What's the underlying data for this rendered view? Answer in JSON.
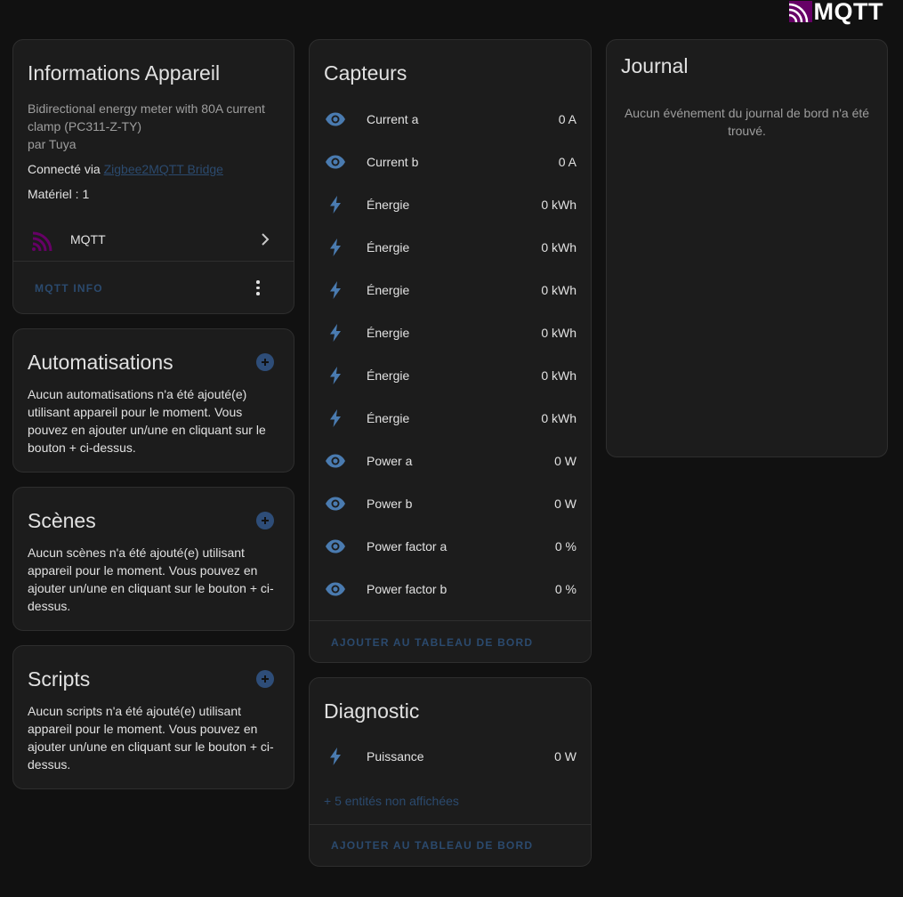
{
  "header": {
    "logo_text": "MQTT"
  },
  "colors": {
    "accent": "#2e4d78",
    "link": "#2b4a6e",
    "icon": "#4a7bb0",
    "mqtt_brand": "#660066"
  },
  "device_info": {
    "title": "Informations Appareil",
    "model": "Bidirectional energy meter with 80A current clamp (PC311-Z-TY)",
    "manufacturer": "par Tuya",
    "connected_label": "Connecté via",
    "connected_link": "Zigbee2MQTT Bridge",
    "hardware": "Matériel : 1",
    "integration_label": "MQTT",
    "action_label": "MQTT INFO"
  },
  "automations": {
    "title": "Automatisations",
    "text": "Aucun automatisations n'a été ajouté(e) utilisant appareil pour le moment. Vous pouvez en ajouter un/une en cliquant sur le bouton + ci-dessus."
  },
  "scenes": {
    "title": "Scènes",
    "text": "Aucun scènes n'a été ajouté(e) utilisant appareil pour le moment. Vous pouvez en ajouter un/une en cliquant sur le bouton + ci-dessus."
  },
  "scripts": {
    "title": "Scripts",
    "text": "Aucun scripts n'a été ajouté(e) utilisant appareil pour le moment. Vous pouvez en ajouter un/une en cliquant sur le bouton + ci-dessus."
  },
  "sensors": {
    "title": "Capteurs",
    "action_label": "AJOUTER AU TABLEAU DE BORD",
    "items": [
      {
        "icon": "eye-icon",
        "name": "Current a",
        "value": "0 A"
      },
      {
        "icon": "eye-icon",
        "name": "Current b",
        "value": "0 A"
      },
      {
        "icon": "flash-icon",
        "name": "Énergie",
        "value": "0 kWh"
      },
      {
        "icon": "flash-icon",
        "name": "Énergie",
        "value": "0 kWh"
      },
      {
        "icon": "flash-icon",
        "name": "Énergie",
        "value": "0 kWh"
      },
      {
        "icon": "flash-icon",
        "name": "Énergie",
        "value": "0 kWh"
      },
      {
        "icon": "flash-icon",
        "name": "Énergie",
        "value": "0 kWh"
      },
      {
        "icon": "flash-icon",
        "name": "Énergie",
        "value": "0 kWh"
      },
      {
        "icon": "eye-icon",
        "name": "Power a",
        "value": "0 W"
      },
      {
        "icon": "eye-icon",
        "name": "Power b",
        "value": "0 W"
      },
      {
        "icon": "eye-icon",
        "name": "Power factor a",
        "value": "0 %"
      },
      {
        "icon": "eye-icon",
        "name": "Power factor b",
        "value": "0 %"
      }
    ]
  },
  "diagnostic": {
    "title": "Diagnostic",
    "items": [
      {
        "icon": "flash-icon",
        "name": "Puissance",
        "value": "0 W"
      }
    ],
    "hidden_entities": "+ 5 entités non affichées",
    "action_label": "AJOUTER AU TABLEAU DE BORD"
  },
  "logbook": {
    "title": "Journal",
    "empty_text": "Aucun événement du journal de bord n'a été trouvé."
  }
}
